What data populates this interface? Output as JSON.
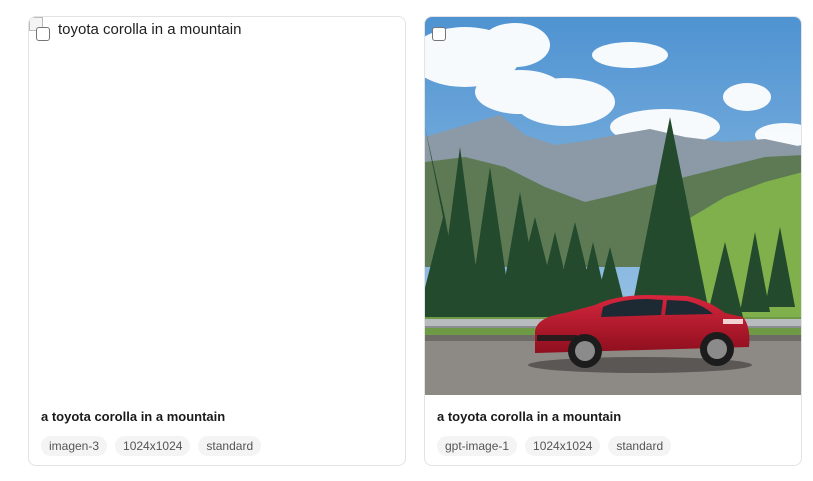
{
  "cards": [
    {
      "image_alt": "toyota corolla in a mountain",
      "caption": "a toyota corolla in a mountain",
      "tags": [
        "imagen-3",
        "1024x1024",
        "standard"
      ]
    },
    {
      "image_alt": "",
      "caption": "a toyota corolla in a mountain",
      "tags": [
        "gpt-image-1",
        "1024x1024",
        "standard"
      ]
    }
  ],
  "colors": {
    "sky": "#5f9fd6",
    "car": "#c0182e",
    "grass": "#6fa845",
    "road": "#8d8a86"
  }
}
